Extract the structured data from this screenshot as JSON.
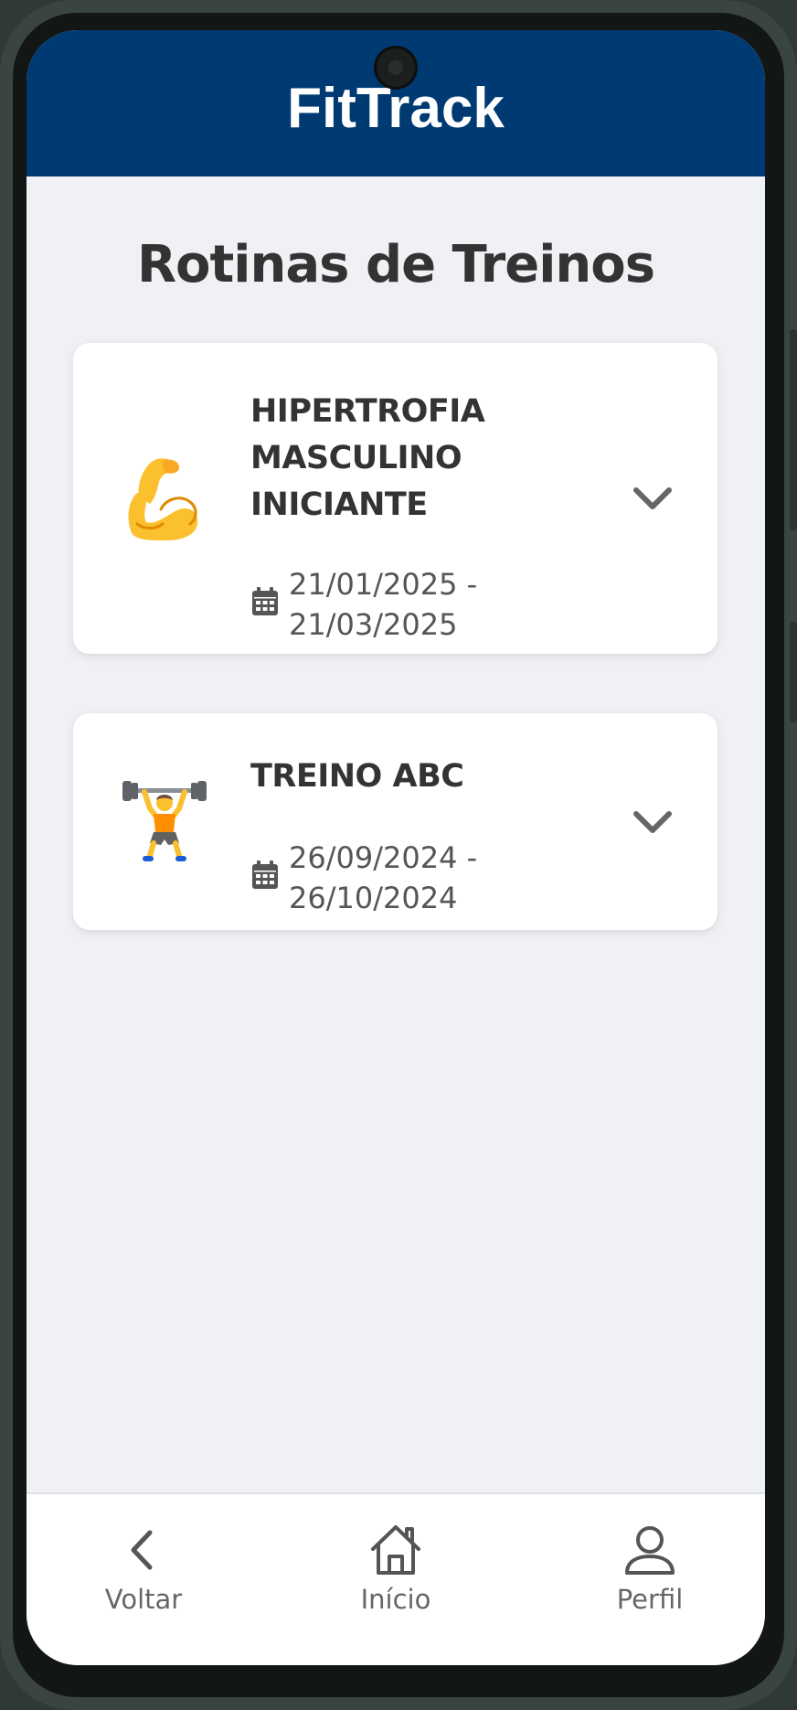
{
  "app": {
    "title": "FitTrack",
    "header_color": "#003a73"
  },
  "page": {
    "title": "Rotinas de Treinos"
  },
  "routines": [
    {
      "name": "HIPERTROFIA MASCULINO INICIANTE",
      "dates": "21/01/2025 - 21/03/2025",
      "icon": "flexed-biceps-icon"
    },
    {
      "name": "TREINO ABC",
      "dates": "26/09/2024 - 26/10/2024",
      "icon": "weightlifter-icon"
    }
  ],
  "nav": {
    "back_label": "Voltar",
    "home_label": "Início",
    "profile_label": "Perfil"
  }
}
